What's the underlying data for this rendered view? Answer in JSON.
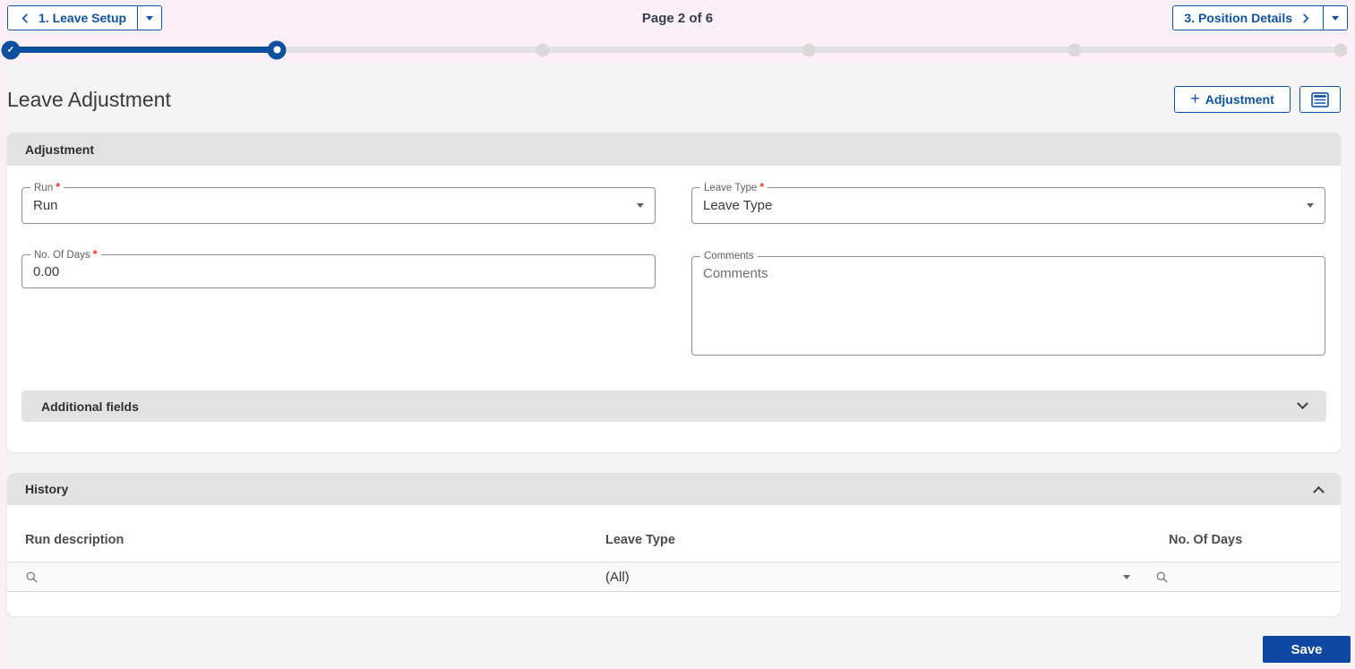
{
  "wizard": {
    "prev": {
      "label": "1. Leave Setup"
    },
    "page_indicator": "Page 2 of 6",
    "next": {
      "label": "3. Position Details"
    },
    "steps_total": 6,
    "current_step": 2,
    "check_icon": "✓"
  },
  "header": {
    "title": "Leave Adjustment",
    "add_adjustment": {
      "icon": "+",
      "label": "Adjustment"
    }
  },
  "adjustment": {
    "section_title": "Adjustment",
    "fields": {
      "run": {
        "label": "Run",
        "value": "Run",
        "required": true
      },
      "leave_type": {
        "label": "Leave Type",
        "value": "Leave Type",
        "required": true
      },
      "no_of_days": {
        "label": "No. Of Days",
        "value": "0.00",
        "required": true
      },
      "comments": {
        "label": "Comments",
        "placeholder": "Comments",
        "required": false
      }
    },
    "additional_fields": {
      "label": "Additional fields",
      "state": "collapsed"
    }
  },
  "history": {
    "section_title": "History",
    "state": "expanded",
    "columns": [
      {
        "label": "Run description",
        "filter": "search"
      },
      {
        "label": "Leave Type",
        "filter": "dropdown",
        "filter_value": "(All)"
      },
      {
        "label": "No. Of Days",
        "filter": "search"
      }
    ],
    "rows": []
  },
  "footer": {
    "save": "Save"
  },
  "colors": {
    "primary_blue": "#1053a4",
    "save_blue": "#0d47a1",
    "section_bar_gray": "#e3e3e4",
    "page_bg": "#f4f4f5",
    "frame_pink": "#fbeff8",
    "required_red": "#e0442c"
  }
}
